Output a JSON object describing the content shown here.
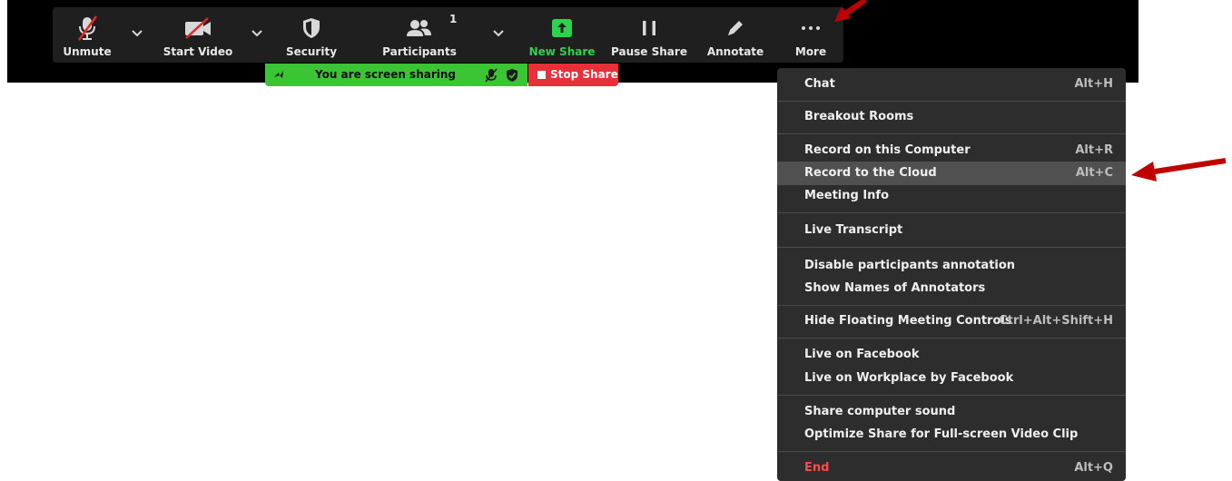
{
  "toolbar": {
    "unmute": "Unmute",
    "start_video": "Start Video",
    "security": "Security",
    "participants": "Participants",
    "participants_count": "1",
    "new_share": "New Share",
    "pause_share": "Pause Share",
    "annotate": "Annotate",
    "more": "More"
  },
  "share_bar": {
    "status": "You are screen sharing",
    "stop": "Stop Share"
  },
  "menu": {
    "chat": {
      "label": "Chat",
      "shortcut": "Alt+H"
    },
    "breakout": {
      "label": "Breakout Rooms"
    },
    "record_computer": {
      "label": "Record on this Computer",
      "shortcut": "Alt+R"
    },
    "record_cloud": {
      "label": "Record to the Cloud",
      "shortcut": "Alt+C"
    },
    "meeting_info": {
      "label": "Meeting Info"
    },
    "live_transcript": {
      "label": "Live Transcript"
    },
    "disable_annotation": {
      "label": "Disable participants annotation"
    },
    "show_names": {
      "label": "Show Names of Annotators"
    },
    "hide_controls": {
      "label": "Hide Floating Meeting Controls",
      "shortcut": "Ctrl+Alt+Shift+H"
    },
    "live_facebook": {
      "label": "Live on Facebook"
    },
    "live_workplace": {
      "label": "Live on Workplace by Facebook"
    },
    "share_sound": {
      "label": "Share computer sound"
    },
    "optimize": {
      "label": "Optimize Share for Full-screen Video Clip"
    },
    "end": {
      "label": "End",
      "shortcut": "Alt+Q"
    }
  },
  "colors": {
    "toolbar_bg": "#1f1f1f",
    "menu_bg": "#2d2d2d",
    "highlight": "#505050",
    "share_green": "#3bc433",
    "stop_red": "#e8303a",
    "arrow_red": "#c00000",
    "end_red": "#ff4a4a"
  }
}
